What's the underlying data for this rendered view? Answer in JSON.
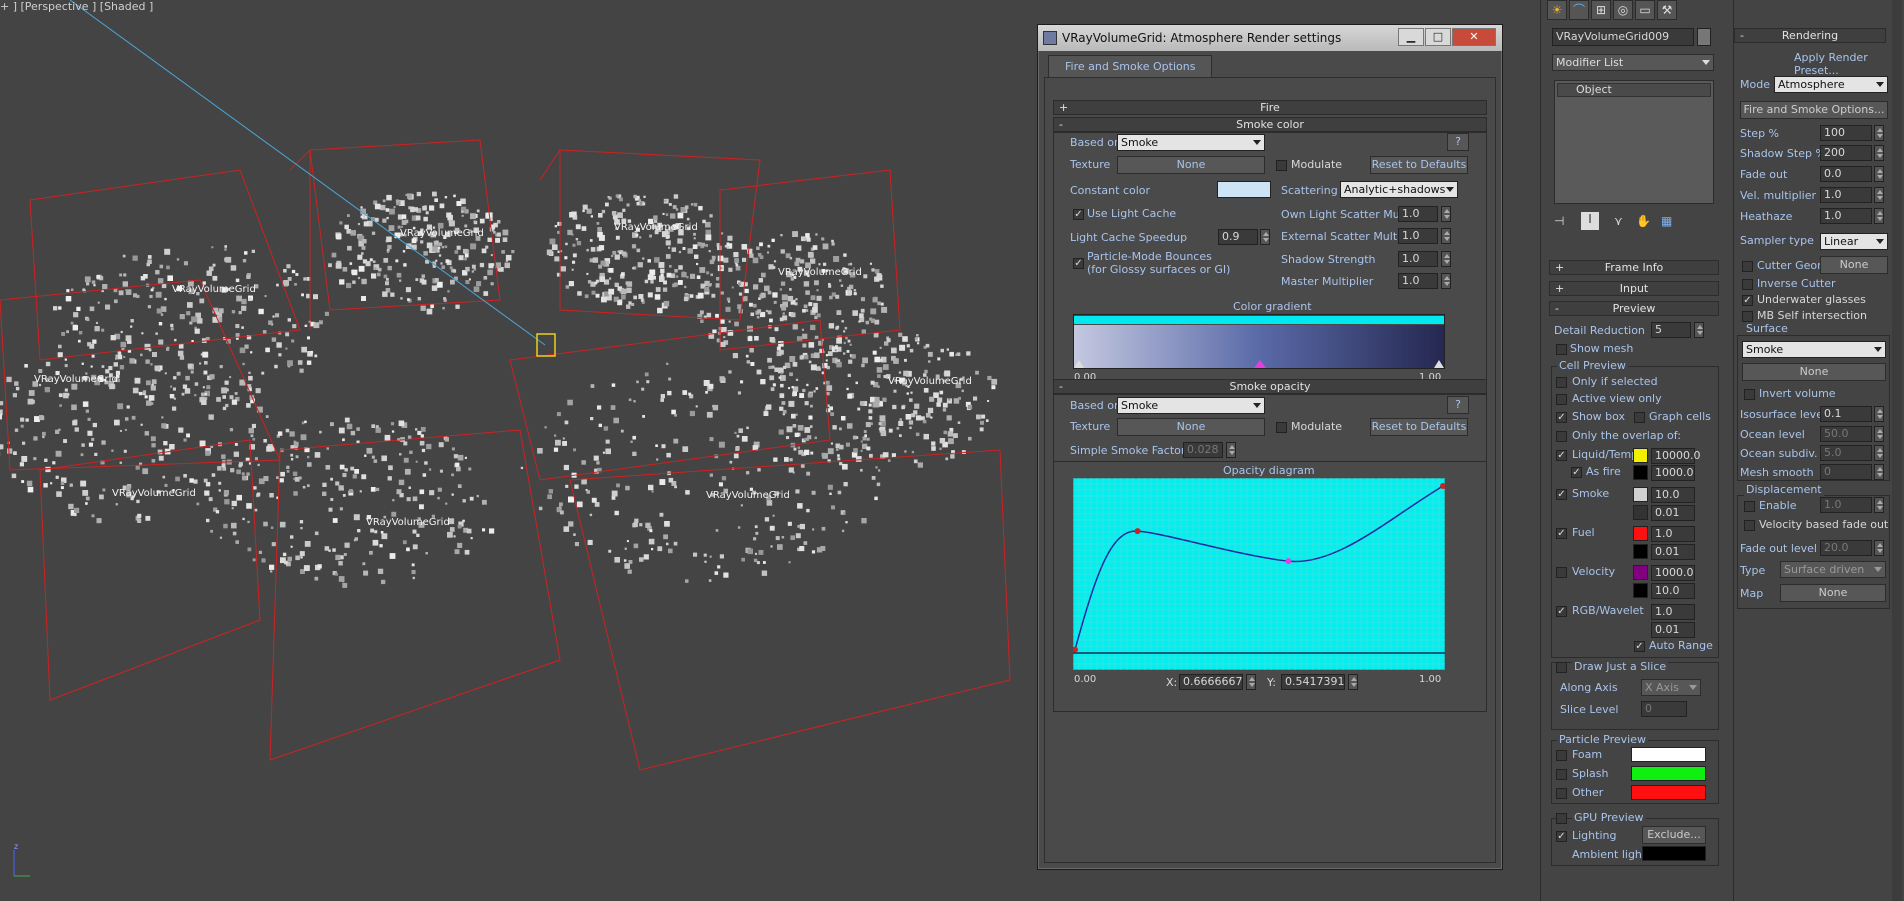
{
  "viewport": {
    "label": "+ ] [Perspective ] [Shaded ]",
    "grid_labels": [
      "VRayVolumeGrid",
      "VRayVolumeGrid",
      "VRayVolumeGrid",
      "VRayVolumeGrid",
      "VRayVolumeGrid",
      "VRayVolumeGrid",
      "VRayVolumeGrid",
      "VRayVolumeGrid",
      "VRayVolumeGrid"
    ],
    "axis_label": "z",
    "colors": {
      "bbox": "#cc2222",
      "cloud": "#d8d8d8",
      "light_line": "#4aa6d8",
      "selection": "#e8d020"
    }
  },
  "dialog": {
    "title": "VRayVolumeGrid: Atmosphere Render settings",
    "min_icon": "minimize-icon",
    "max_icon": "maximize-icon",
    "close_icon": "close-icon",
    "tab": "Fire and Smoke Options",
    "fire_rollout": {
      "sign": "+",
      "label": "Fire"
    },
    "smoke_color": {
      "sign": "-",
      "label": "Smoke color",
      "based_on_label": "Based on",
      "based_on_value": "Smoke",
      "help": "?",
      "texture_label": "Texture",
      "texture_value": "None",
      "modulate": "Modulate",
      "reset": "Reset to Defaults",
      "constant_color_label": "Constant color",
      "constant_color": "#cde3f6",
      "scattering_label": "Scattering",
      "scattering_value": "Analytic+shadows",
      "use_light_cache": "Use Light Cache",
      "own_light_scatter_label": "Own Light Scatter Mult",
      "own_light_scatter": "1.0",
      "light_cache_speedup_label": "Light Cache Speedup",
      "light_cache_speedup": "0.9",
      "external_scatter_label": "External Scatter Mult",
      "external_scatter": "1.0",
      "particle_bounces_1": "Particle-Mode Bounces",
      "particle_bounces_2": "(for Glossy surfaces or GI)",
      "shadow_strength_label": "Shadow Strength",
      "shadow_strength": "1.0",
      "master_multiplier_label": "Master Multiplier",
      "master_multiplier": "1.0",
      "gradient_title": "Color gradient",
      "gradient_min": "0.00",
      "gradient_max": "1.00",
      "gradient_colors": [
        "#c4c8e0",
        "#5a6aa8",
        "#252850"
      ],
      "gradient_bar": "#00e8f0"
    },
    "smoke_opacity": {
      "sign": "-",
      "label": "Smoke opacity",
      "based_on_label": "Based on",
      "based_on_value": "Smoke",
      "help": "?",
      "texture_label": "Texture",
      "texture_value": "None",
      "modulate": "Modulate",
      "reset": "Reset to Defaults",
      "simple_factor_label": "Simple Smoke Factor",
      "simple_factor": "0.028",
      "diagram_title": "Opacity diagram",
      "min": "0.00",
      "max": "1.00",
      "x_label": "X:",
      "x_value": "0.6666667",
      "y_label": "Y:",
      "y_value": "0.5417391",
      "bg": "#00f0f0",
      "curve_color": "#1a2aa0"
    }
  },
  "cmdpanel": {
    "top_icons": [
      "sun-icon",
      "curve-icon",
      "hierarchy-icon",
      "motion-icon",
      "display-icon",
      "hammer-icon"
    ],
    "object_name": "VRayVolumeGrid009",
    "modifier_list": "Modifier List",
    "stack_item": "Object",
    "stack_icons": [
      "pin-icon",
      "bar-icon",
      "fork-icon",
      "hand-icon",
      "config-icon"
    ],
    "frame_info": {
      "sign": "+",
      "label": "Frame Info"
    },
    "input": {
      "sign": "+",
      "label": "Input"
    },
    "preview": {
      "sign": "-",
      "label": "Preview"
    },
    "detail_reduction_label": "Detail Reduction",
    "detail_reduction": "5",
    "show_mesh": "Show mesh",
    "cell_preview": "Cell Preview",
    "only_if_selected": "Only if selected",
    "active_view_only": "Active view only",
    "show_box": "Show box",
    "graph_cells": "Graph cells",
    "only_overlap": "Only the overlap of:",
    "channels": [
      {
        "label": "Liquid/Temp.",
        "color": "#f0f000",
        "v1": "10000.0",
        "v2": "1000.0",
        "extra": "As fire"
      },
      {
        "label": "Smoke",
        "color": "#d0d0d0",
        "v1": "10.0",
        "v2": "0.01",
        "extra": ""
      },
      {
        "label": "Fuel",
        "color": "#ff1010",
        "v1": "1.0",
        "v2": "0.01",
        "extra": ""
      },
      {
        "label": "Velocity",
        "color": "#800080",
        "v1": "1000.0",
        "v2": "10.0",
        "extra": ""
      },
      {
        "label": "RGB/Wavelet",
        "color": "",
        "v1": "1.0",
        "v2": "0.01",
        "extra": ""
      }
    ],
    "auto_range": "Auto Range",
    "draw_slice": "Draw Just a Slice",
    "along_axis_label": "Along Axis",
    "along_axis": "X Axis",
    "slice_level_label": "Slice Level",
    "slice_level": "0",
    "particle_preview": "Particle Preview",
    "particles": [
      {
        "label": "Foam",
        "color": "#ffffff"
      },
      {
        "label": "Splash",
        "color": "#10f010"
      },
      {
        "label": "Other",
        "color": "#ff1010"
      }
    ],
    "gpu_preview": "GPU Preview",
    "lighting": "Lighting",
    "exclude": "Exclude...",
    "ambient_light": "Ambient light",
    "ambient_color": "#000000"
  },
  "rendpanel": {
    "rendering": {
      "sign": "-",
      "label": "Rendering"
    },
    "apply_preset": "Apply Render Preset...",
    "mode_label": "Mode",
    "mode": "Atmosphere",
    "fso_button": "Fire and Smoke Options...",
    "params": [
      {
        "label": "Step %",
        "value": "100"
      },
      {
        "label": "Shadow Step %",
        "value": "200"
      },
      {
        "label": "Fade out",
        "value": "0.0"
      },
      {
        "label": "Vel. multiplier",
        "value": "1.0"
      },
      {
        "label": "Heathaze",
        "value": "1.0"
      }
    ],
    "sampler_label": "Sampler type",
    "sampler": "Linear",
    "cutter_geom": "Cutter Geom",
    "cutter_value": "None",
    "inverse_cutter": "Inverse Cutter",
    "underwater": "Underwater glasses",
    "mb_self": "MB Self intersection",
    "surface_group": "Surface",
    "surface_channel": "Smoke",
    "surface_none": "None",
    "invert_volume": "Invert volume",
    "surface_params": [
      {
        "label": "Isosurface level",
        "value": "0.1"
      },
      {
        "label": "Ocean level",
        "value": "50.0"
      },
      {
        "label": "Ocean subdiv.",
        "value": "5.0"
      },
      {
        "label": "Mesh smooth",
        "value": "0"
      }
    ],
    "displacement_group": "Displacement",
    "enable": "Enable",
    "enable_value": "1.0",
    "velocity_fade": "Velocity based fade out",
    "fade_out_level_label": "Fade out level",
    "fade_out_level": "20.0",
    "type_label": "Type",
    "type": "Surface driven",
    "map_label": "Map",
    "map": "None"
  }
}
